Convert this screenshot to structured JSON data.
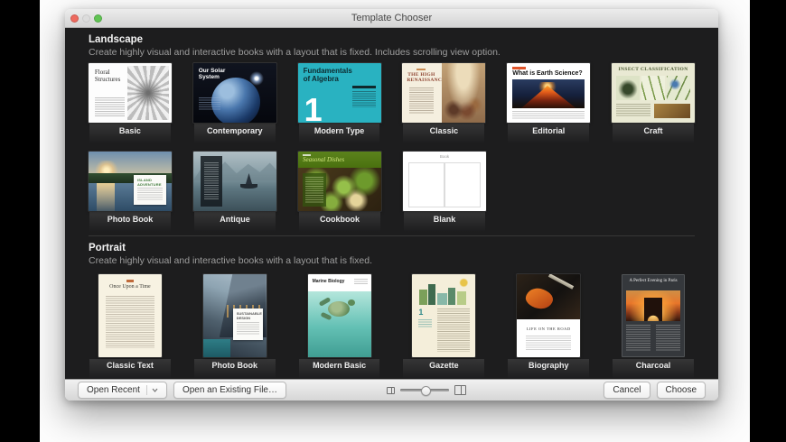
{
  "window": {
    "title": "Template Chooser"
  },
  "traffic_lights": {
    "close": "#ee6a5f",
    "minimize_disabled": "#dcdcdc",
    "zoom": "#61c454"
  },
  "sections": {
    "landscape": {
      "title": "Landscape",
      "description": "Create highly visual and interactive books with a layout that is fixed. Includes scrolling view option."
    },
    "portrait": {
      "title": "Portrait",
      "description": "Create highly visual and interactive books with a layout that is fixed."
    }
  },
  "templates": {
    "landscape": [
      {
        "name": "Basic",
        "cover_title": "Floral Structures"
      },
      {
        "name": "Contemporary",
        "cover_title": "Our Solar System"
      },
      {
        "name": "Modern Type",
        "cover_title": "Fundamentals of Algebra",
        "cover_numeral": "1"
      },
      {
        "name": "Classic",
        "cover_title": "THE HIGH RENAISSANCE"
      },
      {
        "name": "Editorial",
        "cover_title": "What is Earth Science?"
      },
      {
        "name": "Craft",
        "cover_title": "INSECT CLASSIFICATION"
      },
      {
        "name": "Photo Book",
        "cover_title": "ISLAND ADVENTURE"
      },
      {
        "name": "Antique"
      },
      {
        "name": "Cookbook",
        "cover_title": "Seasonal Dishes"
      },
      {
        "name": "Blank",
        "cover_title": "Book"
      }
    ],
    "portrait": [
      {
        "name": "Classic Text",
        "cover_title": "Once Upon a Time"
      },
      {
        "name": "Photo Book",
        "cover_title": "SUSTAINABLE DESIGN"
      },
      {
        "name": "Modern Basic",
        "cover_title": "Marine Biology"
      },
      {
        "name": "Gazette",
        "cover_numeral": "1"
      },
      {
        "name": "Biography",
        "cover_title": "LIFE ON THE ROAD"
      },
      {
        "name": "Charcoal",
        "cover_title": "A Perfect Evening in Paris"
      }
    ]
  },
  "footer": {
    "open_recent_label": "Open Recent",
    "open_existing_label": "Open an Existing File…",
    "cancel_label": "Cancel",
    "choose_label": "Choose",
    "zoom_slider_percent": 50
  }
}
